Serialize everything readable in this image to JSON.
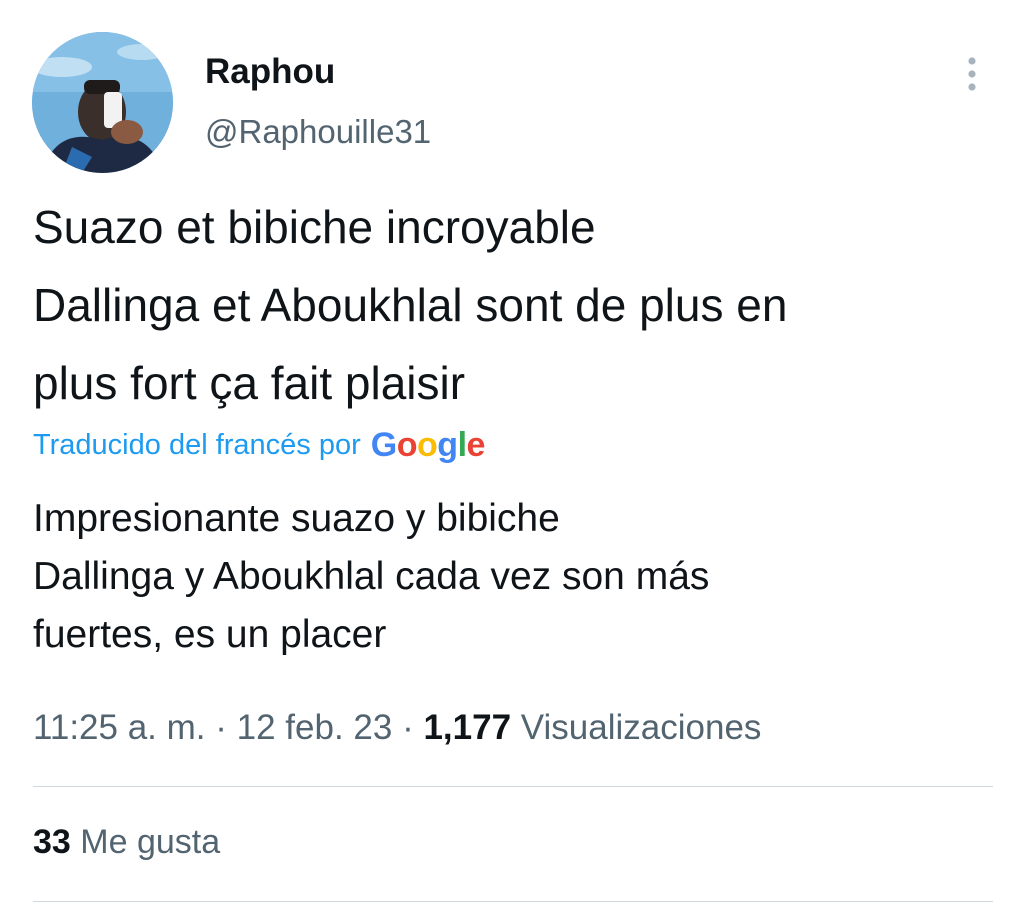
{
  "author": {
    "display_name": "Raphou",
    "handle": "@Raphouille31",
    "avatar_icon": "user-avatar-photo"
  },
  "more_icon": "more-vertical-icon",
  "tweet": {
    "lines": [
      "Suazo et bibiche incroyable",
      "Dallinga et Aboukhlal sont de plus en",
      "plus fort ça fait plaisir"
    ]
  },
  "translation": {
    "label": "Traducido del francés por",
    "provider": "Google",
    "provider_colors": [
      "#4285F4",
      "#EA4335",
      "#FBBC05",
      "#4285F4",
      "#34A853",
      "#EA4335"
    ],
    "lines": [
      "Impresionante suazo y bibiche",
      "Dallinga y Aboukhlal cada vez son más",
      "fuertes, es un placer"
    ]
  },
  "meta": {
    "time": "11:25 a. m.",
    "separator": "·",
    "date": "12 feb. 23",
    "views_count": "1,177",
    "views_label": "Visualizaciones"
  },
  "likes": {
    "count": "33",
    "label": "Me gusta"
  },
  "colors": {
    "text": "#0f1419",
    "secondary": "#536471",
    "link": "#1d9bf0",
    "divider": "#cfd9de"
  }
}
